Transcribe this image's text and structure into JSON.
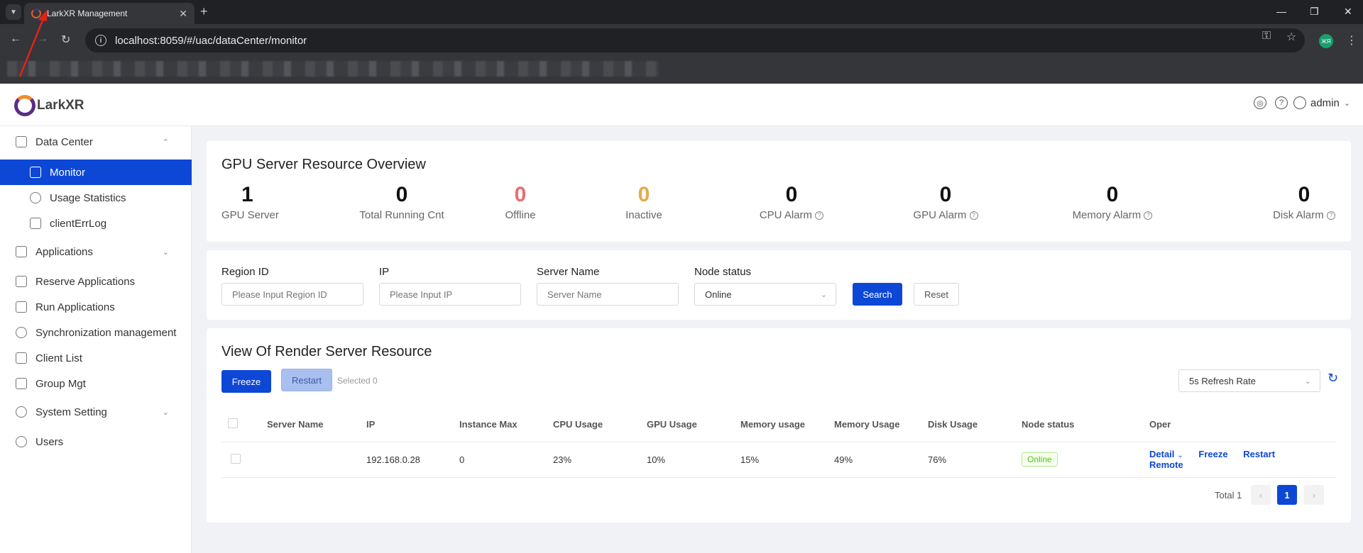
{
  "browser": {
    "tab_title": "LarkXR Management",
    "url": "localhost:8059/#/uac/dataCenter/monitor",
    "profile_initial": "ЖЯ"
  },
  "header": {
    "logo_text": "LarkXR",
    "user_name": "admin"
  },
  "sidebar": {
    "items": [
      {
        "label": "Data Center",
        "icon": "chart-icon"
      },
      {
        "label": "Monitor",
        "icon": "monitor-icon"
      },
      {
        "label": "Usage Statistics",
        "icon": "pie-icon"
      },
      {
        "label": "clientErrLog",
        "icon": "file-icon"
      },
      {
        "label": "Applications",
        "icon": "grid-icon"
      },
      {
        "label": "Reserve Applications",
        "icon": "folder-icon"
      },
      {
        "label": "Run Applications",
        "icon": "doc-icon"
      },
      {
        "label": "Synchronization management",
        "icon": "sync-icon"
      },
      {
        "label": "Client List",
        "icon": "list-icon"
      },
      {
        "label": "Group Mgt",
        "icon": "layers-icon"
      },
      {
        "label": "System Setting",
        "icon": "gear-icon"
      },
      {
        "label": "Users",
        "icon": "user-icon"
      }
    ]
  },
  "overview": {
    "title": "GPU Server Resource Overview",
    "stats": [
      {
        "value": "1",
        "label": "GPU Server",
        "color": "#111111",
        "help": false
      },
      {
        "value": "0",
        "label": "Total Running Cnt",
        "color": "#111111",
        "help": false
      },
      {
        "value": "0",
        "label": "Offline",
        "color": "#e86f6f",
        "help": false
      },
      {
        "value": "0",
        "label": "Inactive",
        "color": "#e8a84a",
        "help": false
      },
      {
        "value": "0",
        "label": "CPU Alarm",
        "color": "#111111",
        "help": true
      },
      {
        "value": "0",
        "label": "GPU Alarm",
        "color": "#111111",
        "help": true
      },
      {
        "value": "0",
        "label": "Memory Alarm",
        "color": "#111111",
        "help": true
      },
      {
        "value": "0",
        "label": "Disk Alarm",
        "color": "#111111",
        "help": true
      }
    ]
  },
  "filters": {
    "region": {
      "label": "Region ID",
      "placeholder": "Please Input Region ID"
    },
    "ip": {
      "label": "IP",
      "placeholder": "Please Input IP"
    },
    "server": {
      "label": "Server Name",
      "placeholder": "Server Name"
    },
    "status": {
      "label": "Node status",
      "value": "Online"
    },
    "search_label": "Search",
    "reset_label": "Reset"
  },
  "resource": {
    "title": "View Of Render Server Resource",
    "freeze_label": "Freeze",
    "restart_label": "Restart",
    "selected_text": "Selected 0",
    "refresh_rate": "5s Refresh Rate",
    "columns": [
      "Server Name",
      "IP",
      "Instance Max",
      "CPU Usage",
      "GPU Usage",
      "Memory usage",
      "Memory Usage",
      "Disk Usage",
      "Node status",
      "Oper"
    ],
    "rows": [
      {
        "server_name": "",
        "ip": "192.168.0.28",
        "instance_max": "0",
        "cpu": "23%",
        "gpu": "10%",
        "memory1": "15%",
        "memory2": "49%",
        "disk": "76%",
        "status": "Online",
        "ops": {
          "detail": "Detail",
          "freeze": "Freeze",
          "restart": "Restart",
          "remote": "Remote"
        }
      }
    ],
    "total_text": "Total 1",
    "current_page": "1"
  }
}
